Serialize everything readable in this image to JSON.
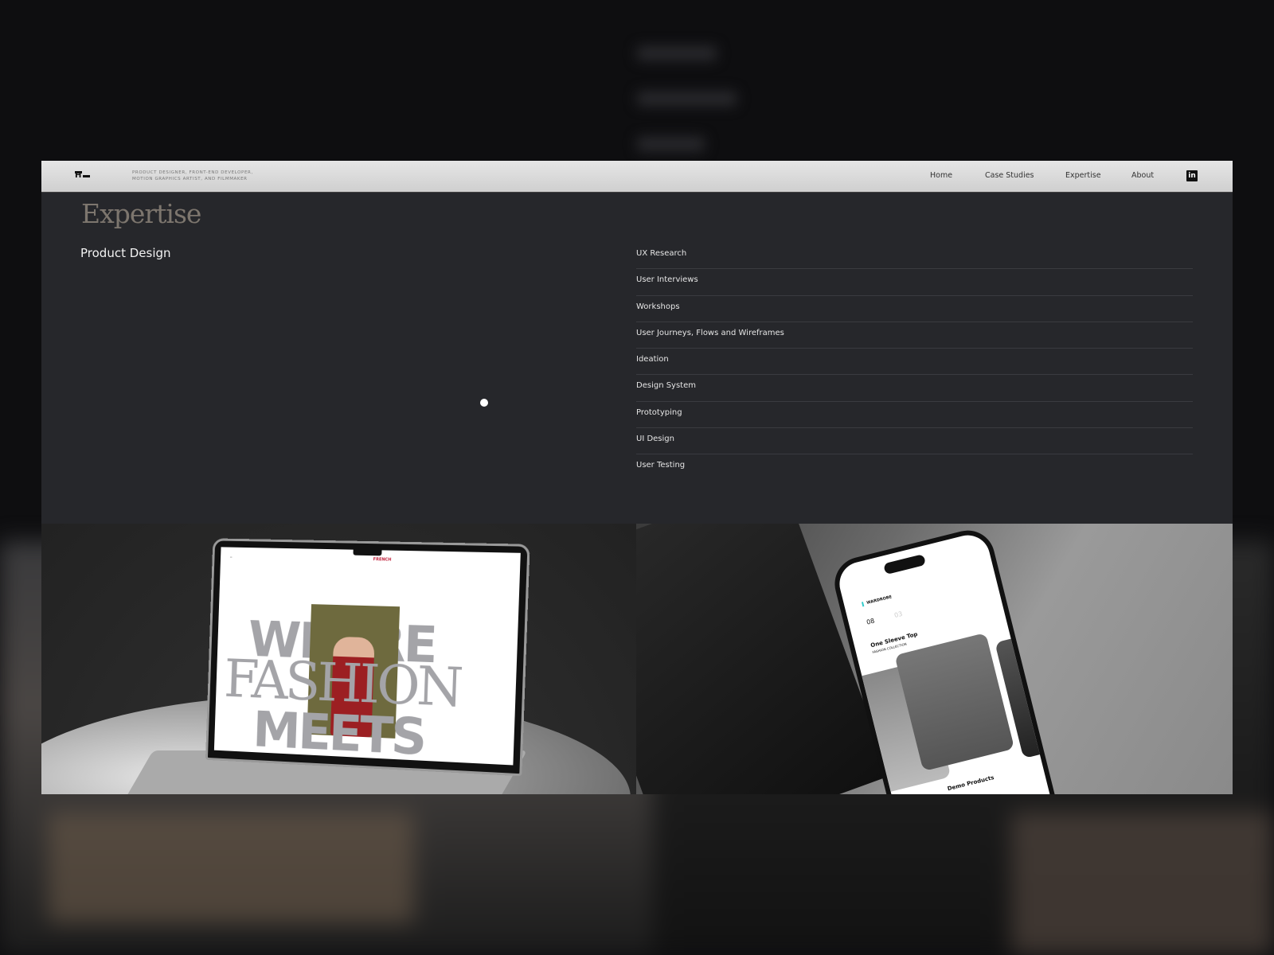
{
  "header": {
    "logo": "H",
    "tagline_line1": "Product designer, front-end developer,",
    "tagline_line2": "motion graphics artist, and filmmaker",
    "nav": [
      {
        "label": "Home"
      },
      {
        "label": "Case Studies"
      },
      {
        "label": "Expertise"
      },
      {
        "label": "About"
      }
    ],
    "linkedin_icon": "in"
  },
  "main": {
    "title": "Expertise",
    "category": "Product Design",
    "skills": [
      "UX Research",
      "User Interviews",
      "Workshops",
      "User Journeys, Flows and Wireframes",
      "Ideation",
      "Design System",
      "Prototyping",
      "UI Design",
      "User Testing"
    ]
  },
  "mockups": {
    "laptop": {
      "brand": "FRENCH",
      "headline_1": "WHERE",
      "headline_2": "FASHION",
      "headline_3": "MEETS"
    },
    "phone": {
      "app": "WARDROBE",
      "count": "08",
      "saved": "03",
      "product_title": "One Sleeve Top",
      "product_sub": "FASHION COLLECTION",
      "section": "Demo Products"
    }
  },
  "colors": {
    "panel_bg": "#26272b",
    "header_bg": "#d9d9d9",
    "title": "#7d766e"
  }
}
